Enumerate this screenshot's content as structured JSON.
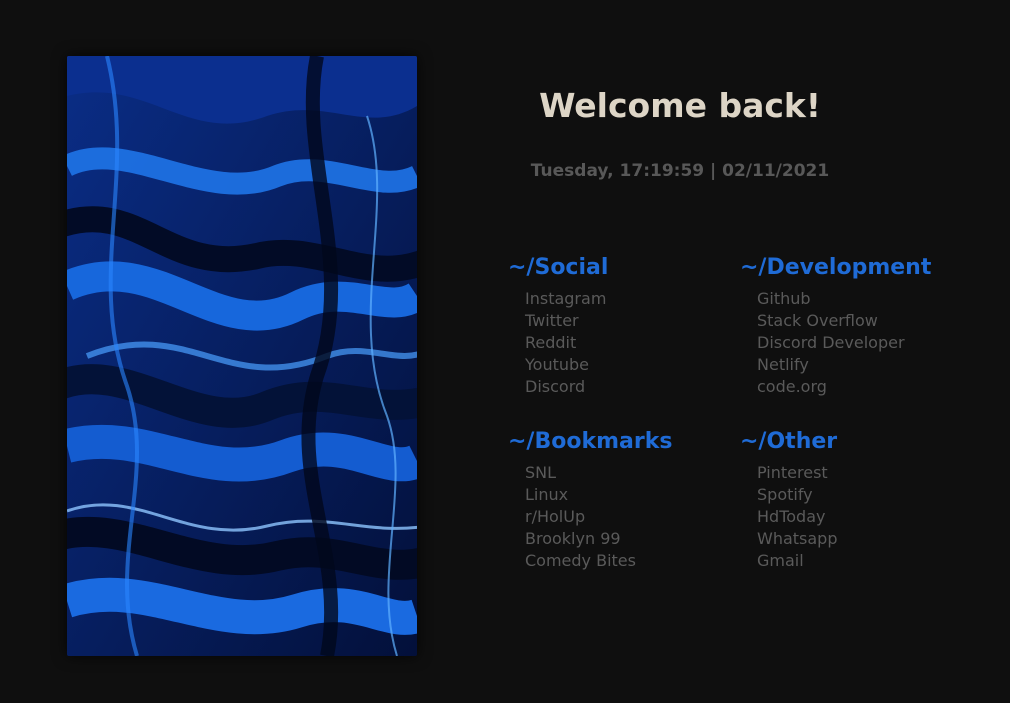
{
  "welcome": "Welcome back!",
  "clock": "Tuesday, 17:19:59 | 02/11/2021",
  "colors": {
    "background": "#0f0f0f",
    "heading": "#ddd5c6",
    "clock": "#585858",
    "category": "#1f6bd6",
    "link": "#5a5a5a"
  },
  "groups": [
    {
      "title": "~/Social",
      "links": [
        "Instagram",
        "Twitter",
        "Reddit",
        "Youtube",
        "Discord"
      ]
    },
    {
      "title": "~/Development",
      "links": [
        "Github",
        "Stack Overflow",
        "Discord Developer",
        "Netlify",
        "code.org"
      ]
    },
    {
      "title": "~/Bookmarks",
      "links": [
        "SNL",
        "Linux",
        "r/HolUp",
        "Brooklyn 99",
        "Comedy Bites"
      ]
    },
    {
      "title": "~/Other",
      "links": [
        "Pinterest",
        "Spotify",
        "HdToday",
        "Whatsapp",
        "Gmail"
      ]
    }
  ]
}
